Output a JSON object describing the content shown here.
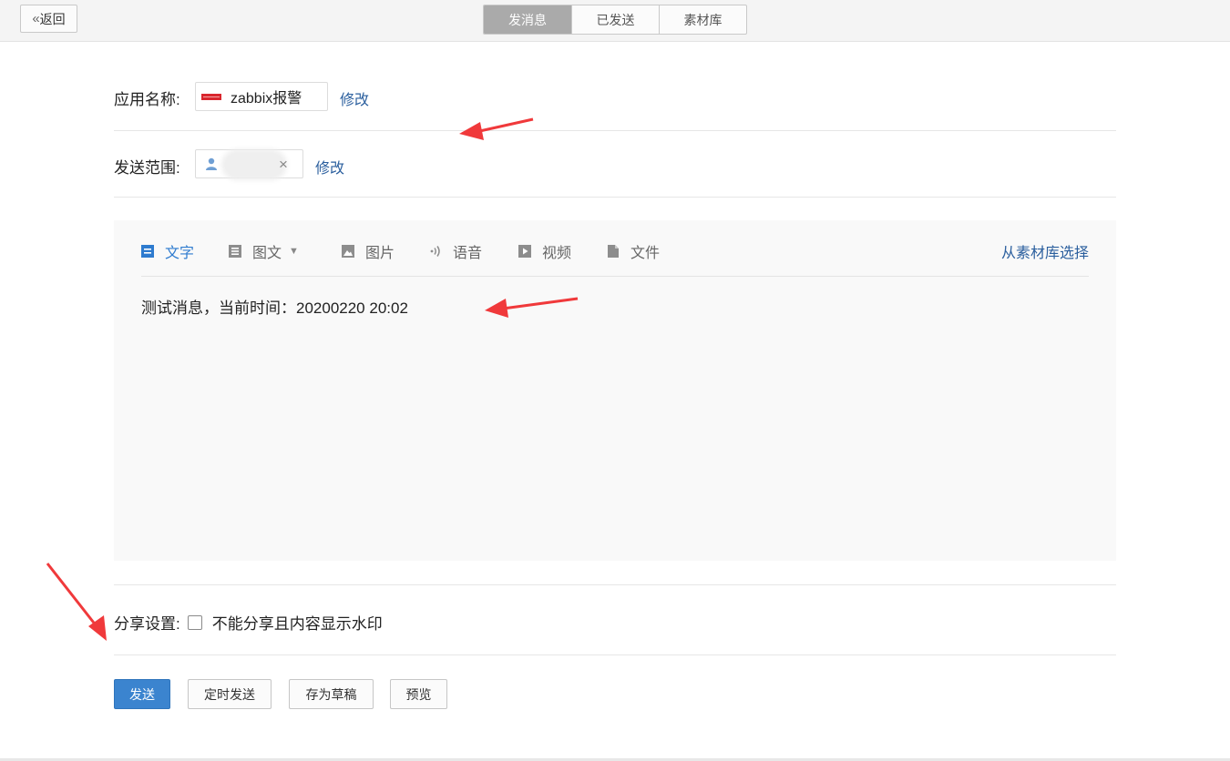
{
  "topbar": {
    "back_label": "返回",
    "tabs": [
      {
        "label": "发消息",
        "active": true
      },
      {
        "label": "已发送",
        "active": false
      },
      {
        "label": "素材库",
        "active": false
      }
    ]
  },
  "form": {
    "app_label": "应用名称:",
    "app_name": "zabbix报警",
    "app_edit": "修改",
    "scope_label": "发送范围:",
    "scope_remove": "×",
    "scope_edit": "修改"
  },
  "editor": {
    "tools": [
      {
        "label": "文字",
        "icon": "text-icon",
        "active": true
      },
      {
        "label": "图文",
        "icon": "article-icon",
        "active": false,
        "caret": "▼"
      },
      {
        "label": "图片",
        "icon": "image-icon",
        "active": false
      },
      {
        "label": "语音",
        "icon": "voice-icon",
        "active": false
      },
      {
        "label": "视频",
        "icon": "video-icon",
        "active": false
      },
      {
        "label": "文件",
        "icon": "file-icon",
        "active": false
      }
    ],
    "pick_library": "从素材库选择",
    "content": "测试消息，当前时间：20200220 20:02"
  },
  "share": {
    "label": "分享设置:",
    "option": "不能分享且内容显示水印",
    "checked": false
  },
  "actions": {
    "send": "发送",
    "schedule": "定时发送",
    "draft": "存为草稿",
    "preview": "预览"
  },
  "colors": {
    "accent": "#3b84cf",
    "link": "#2b5f9e",
    "active_tool": "#2e7bcf",
    "annotation_arrow": "#f0393b"
  }
}
